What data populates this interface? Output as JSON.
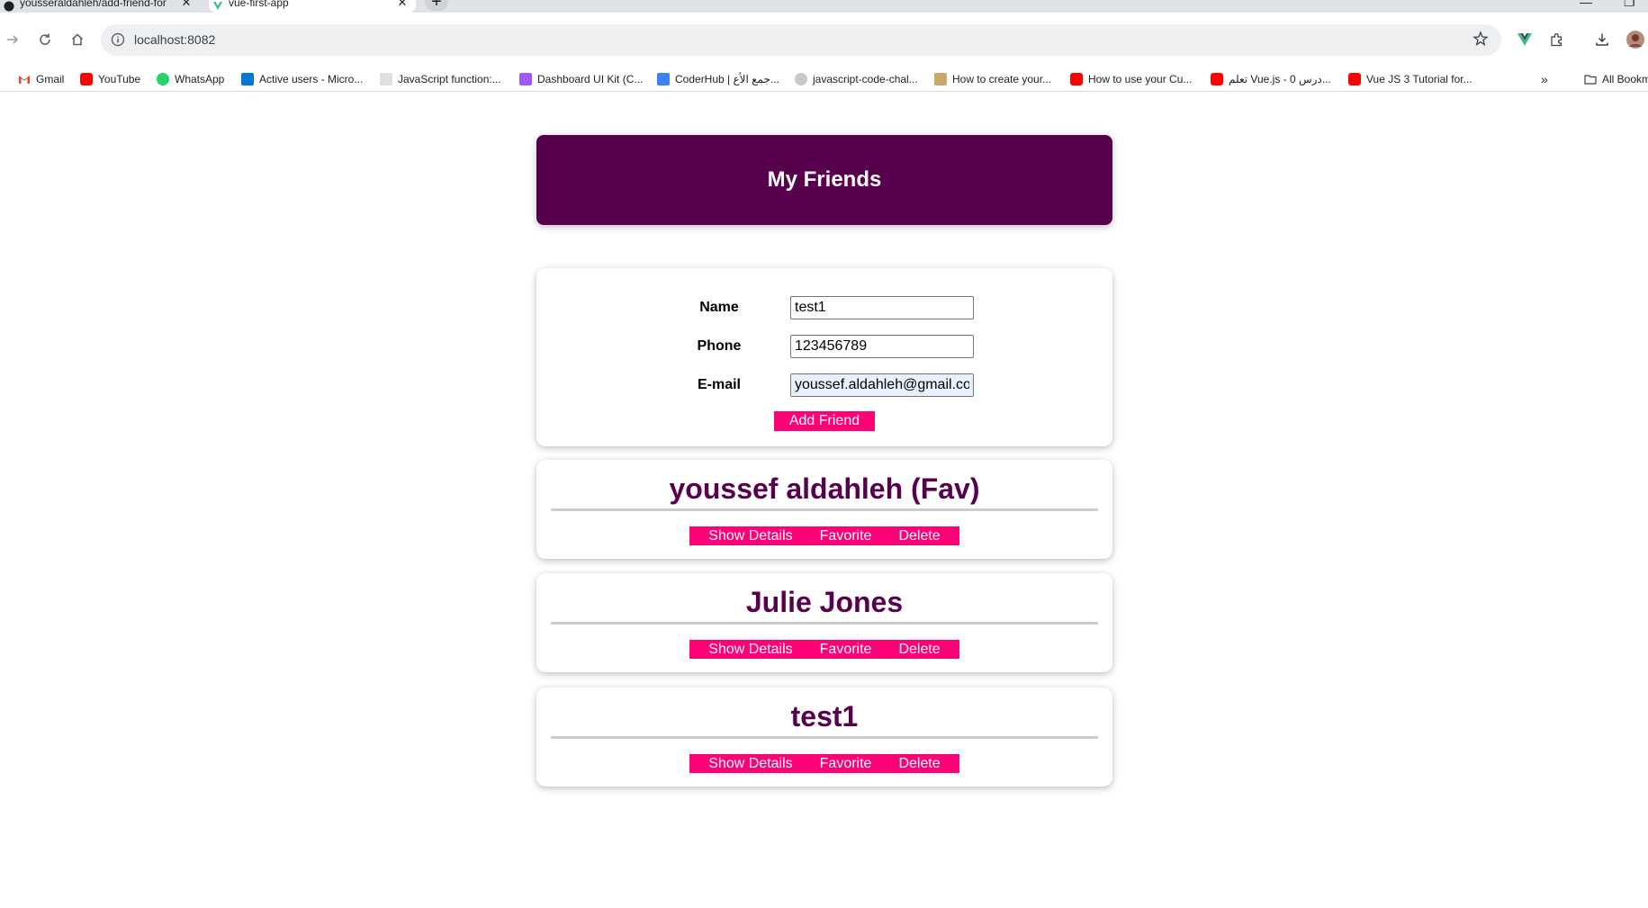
{
  "browser": {
    "tabs": [
      {
        "title": "yousseraldahleh/add-friend-for",
        "active": false
      },
      {
        "title": "vue-first-app",
        "active": true
      }
    ],
    "url": "localhost:8082",
    "bookmarks": [
      {
        "label": "Gmail",
        "icon": "gmail-icon",
        "color": "#ea4335"
      },
      {
        "label": "YouTube",
        "icon": "youtube-icon",
        "color": "#ff0000"
      },
      {
        "label": "WhatsApp",
        "icon": "whatsapp-icon",
        "color": "#25d366"
      },
      {
        "label": "Active users - Micro...",
        "icon": "azure-icon",
        "color": "#0078d4"
      },
      {
        "label": "JavaScript function:...",
        "icon": "w3schools-icon",
        "color": "#9e9e9e"
      },
      {
        "label": "Dashboard UI Kit (C...",
        "icon": "figma-icon",
        "color": "#a259ff"
      },
      {
        "label": "CoderHub | جمع الأع...",
        "icon": "coderhub-icon",
        "color": "#3b82f6"
      },
      {
        "label": "javascript-code-chal...",
        "icon": "github-icon",
        "color": "#6e7681"
      },
      {
        "label": "How to create your...",
        "icon": "question-icon",
        "color": "#c9a86a"
      },
      {
        "label": "How to use your Cu...",
        "icon": "youtube-icon",
        "color": "#ff0000"
      },
      {
        "label": "تعلم Vue.js - درس 0...",
        "icon": "youtube-icon",
        "color": "#ff0000"
      },
      {
        "label": "Vue JS 3 Tutorial for...",
        "icon": "youtube-icon",
        "color": "#ff0000"
      }
    ],
    "all_bookmarks_label": "All Bookmarks"
  },
  "app": {
    "title": "My Friends",
    "form": {
      "name_label": "Name",
      "name_value": "test1",
      "phone_label": "Phone",
      "phone_value": "123456789",
      "email_label": "E-mail",
      "email_value": "youssef.aldahleh@gmail.co",
      "submit_label": "Add Friend"
    },
    "friends": [
      {
        "name": "youssef aldahleh (Fav)"
      },
      {
        "name": "Julie Jones"
      },
      {
        "name": "test1"
      }
    ],
    "actions": {
      "details": "Show Details",
      "favorite": "Favorite",
      "delete": "Delete"
    }
  },
  "colors": {
    "header_bg": "#58004d",
    "button_bg": "#ff0077",
    "name_color": "#58004d"
  }
}
